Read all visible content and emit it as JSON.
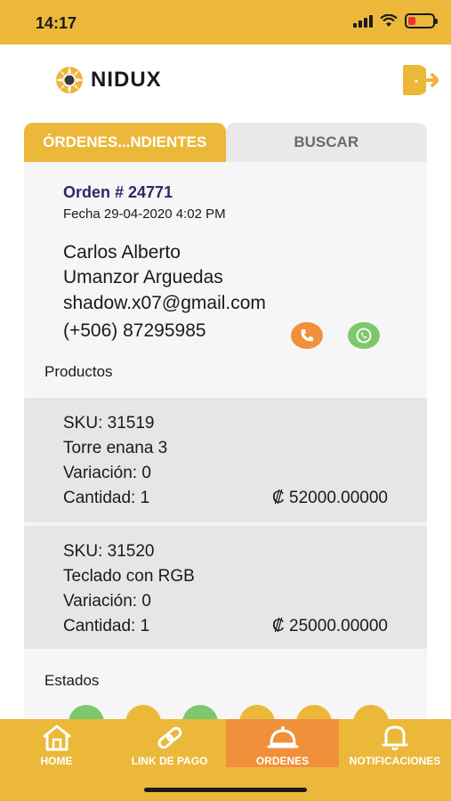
{
  "status_bar": {
    "time": "14:17"
  },
  "header": {
    "brand": "NIDUX"
  },
  "tabs": [
    {
      "label": "ÓRDENES...NDIENTES",
      "active": true
    },
    {
      "label": "BUSCAR",
      "active": false
    }
  ],
  "order": {
    "title": "Orden # 24771",
    "date": "Fecha 29-04-2020 4:02 PM",
    "customer_first": "Carlos Alberto",
    "customer_last": "Umanzor Arguedas",
    "email": "shadow.x07@gmail.com",
    "phone": "(+506) 87295985"
  },
  "products_label": "Productos",
  "products": [
    {
      "sku": "SKU: 31519",
      "name": "Torre enana 3",
      "variation": "Variación: 0",
      "quantity": "Cantidad: 1",
      "price": "₡ 52000.00000"
    },
    {
      "sku": "SKU: 31520",
      "name": "Teclado con RGB",
      "variation": "Variación: 0",
      "quantity": "Cantidad: 1",
      "price": "₡ 25000.00000"
    }
  ],
  "states_label": "Estados",
  "bottom_nav": [
    {
      "label": "HOME",
      "icon": "home-icon",
      "active": false
    },
    {
      "label": "LINK DE PAGO",
      "icon": "link-icon",
      "active": false
    },
    {
      "label": "ORDENES",
      "icon": "bell-service-icon",
      "active": true
    },
    {
      "label": "NOTIFICACIONES",
      "icon": "notification-bell-icon",
      "active": false
    }
  ],
  "colors": {
    "brand": "#ebb83a",
    "accent_orange": "#f0903a",
    "whatsapp_green": "#7ec86b",
    "order_title": "#2b2b66"
  }
}
